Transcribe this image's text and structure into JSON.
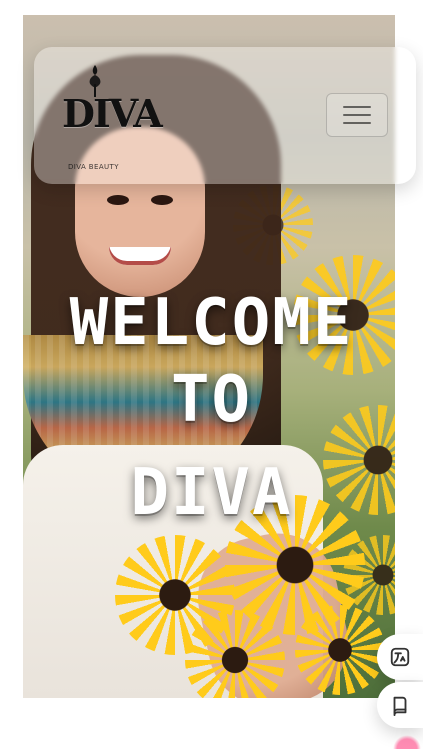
{
  "header": {
    "logo": {
      "text": "DIVA",
      "subtext": "DIVA BEAUTY"
    },
    "menu_button_aria": "Menu"
  },
  "hero": {
    "title_lines": [
      "WELCOME",
      "TO",
      "DIVA"
    ]
  },
  "floating_actions": {
    "translate_label": "Translate",
    "reader_label": "Reader"
  },
  "colors": {
    "accent": "#ffcb2b",
    "text": "#ffffff"
  }
}
